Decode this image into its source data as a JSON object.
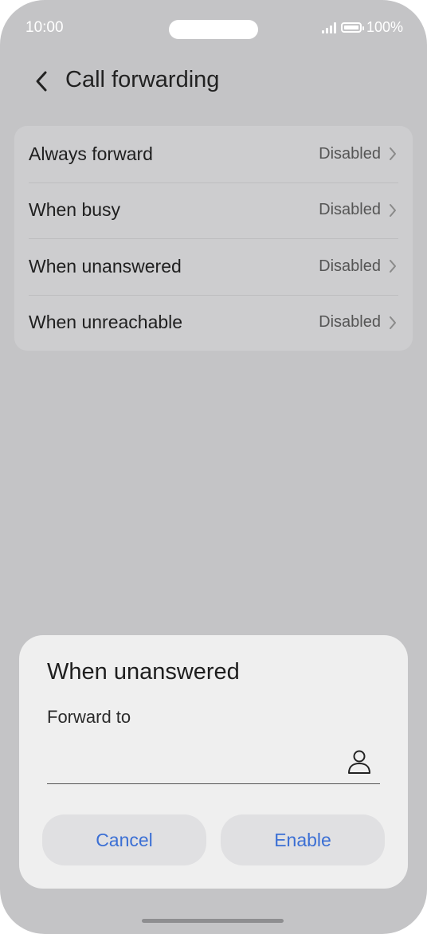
{
  "status_bar": {
    "time": "10:00",
    "battery": "100%"
  },
  "header": {
    "title": "Call forwarding"
  },
  "forwarding_options": [
    {
      "label": "Always forward",
      "value": "Disabled"
    },
    {
      "label": "When busy",
      "value": "Disabled"
    },
    {
      "label": "When unanswered",
      "value": "Disabled"
    },
    {
      "label": "When unreachable",
      "value": "Disabled"
    }
  ],
  "dialog": {
    "title": "When unanswered",
    "field_label": "Forward to",
    "field_value": "",
    "cancel_label": "Cancel",
    "enable_label": "Enable"
  },
  "colors": {
    "accent": "#3b6fd4",
    "background": "#c4c4c6",
    "sheet": "#efefef"
  }
}
